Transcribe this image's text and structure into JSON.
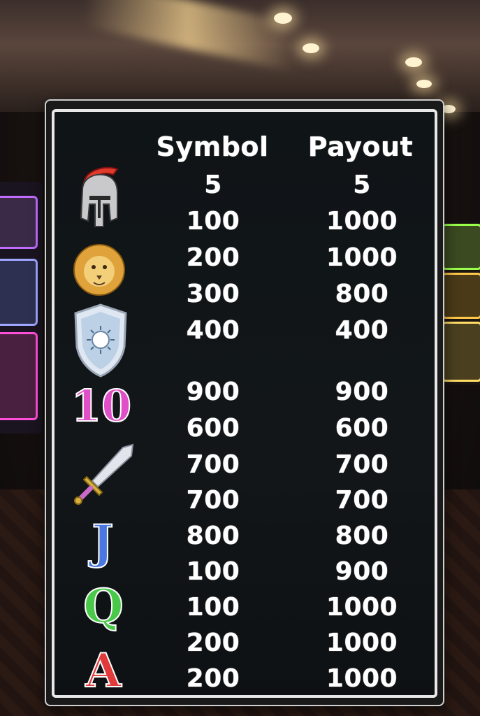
{
  "headers": {
    "symbol": "Symbol",
    "payout": "Payout"
  },
  "count_row": {
    "symbol": "5",
    "payout": "5"
  },
  "rows": [
    {
      "symbol": "100",
      "payout": "1000"
    },
    {
      "symbol": "200",
      "payout": "1000"
    },
    {
      "symbol": "300",
      "payout": "800"
    },
    {
      "symbol": "400",
      "payout": "400"
    },
    {
      "symbol": "900",
      "payout": "900"
    },
    {
      "symbol": "600",
      "payout": "600"
    },
    {
      "symbol": "700",
      "payout": "700"
    },
    {
      "symbol": "700",
      "payout": "700"
    },
    {
      "symbol": "800",
      "payout": "800"
    },
    {
      "symbol": "100",
      "payout": "900"
    },
    {
      "symbol": "100",
      "payout": "1000"
    },
    {
      "symbol": "200",
      "payout": "1000"
    },
    {
      "symbol": "200",
      "payout": "1000"
    }
  ],
  "icons": [
    {
      "name": "helmet-icon"
    },
    {
      "name": "lion-icon"
    },
    {
      "name": "shield-icon"
    },
    {
      "name": "ten-icon",
      "text": "10",
      "color": "#e04fc8"
    },
    {
      "name": "sword-icon"
    },
    {
      "name": "jack-icon",
      "text": "J",
      "color": "#4a78e0"
    },
    {
      "name": "queen-icon",
      "text": "Q",
      "color": "#4ac84a"
    },
    {
      "name": "ace-icon",
      "text": "A",
      "color": "#e03a3a"
    }
  ],
  "colors": {
    "text": "#ffffff",
    "sign_bg": "#121619",
    "border": "#e8e8e8"
  }
}
